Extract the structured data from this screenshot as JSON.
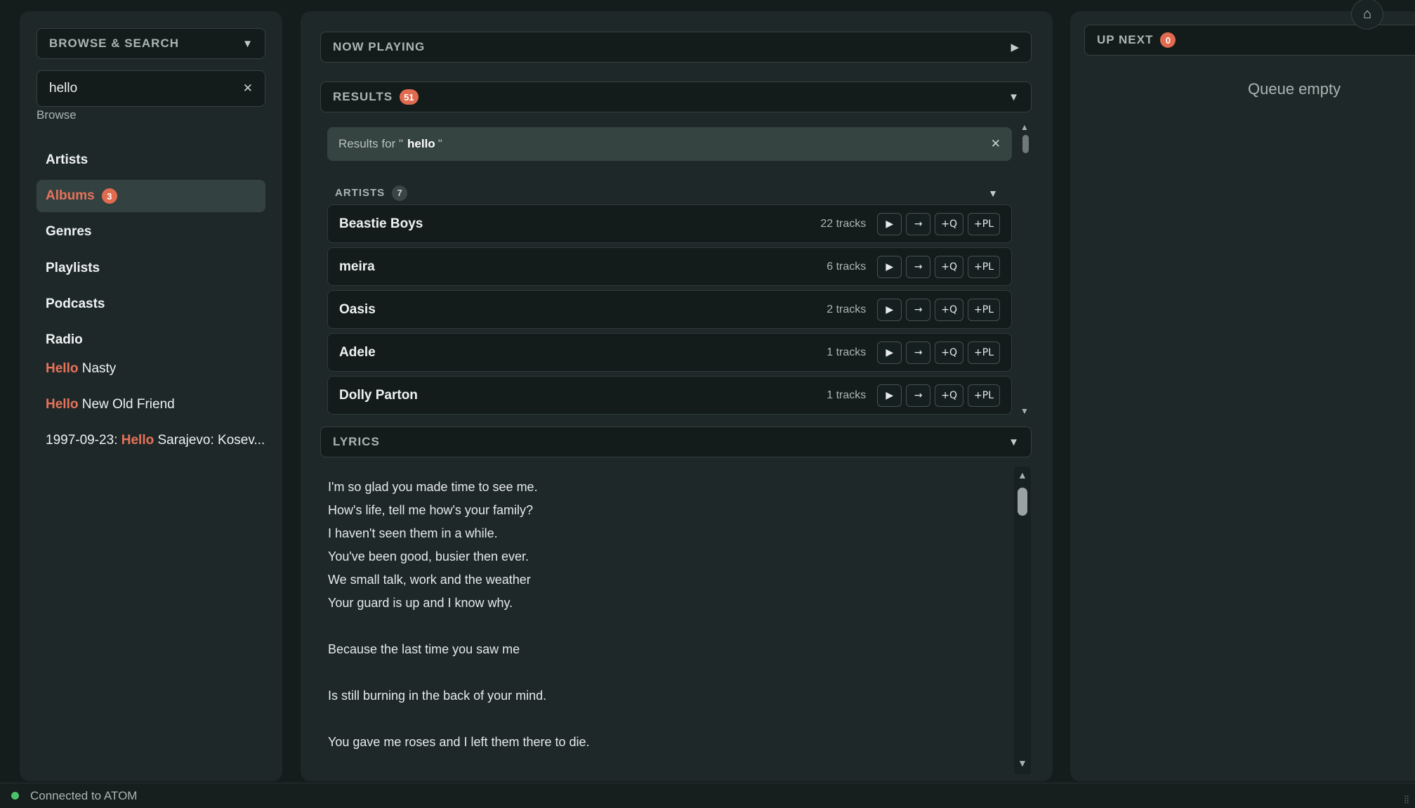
{
  "left": {
    "browse_title": "BROWSE & SEARCH",
    "search": {
      "value": "hello"
    },
    "browse_label": "Browse",
    "nav": [
      {
        "label": "Artists"
      },
      {
        "label": "Albums",
        "badge": "3"
      },
      {
        "label": "Genres"
      },
      {
        "label": "Playlists"
      },
      {
        "label": "Podcasts"
      },
      {
        "label": "Radio"
      }
    ],
    "suggestions": [
      {
        "prefix": "",
        "highlight": "Hello",
        "suffix": " Nasty"
      },
      {
        "prefix": "",
        "highlight": "Hello",
        "suffix": " New Old Friend"
      },
      {
        "prefix": "1997-09-23: ",
        "highlight": "Hello",
        "suffix": " Sarajevo: Kosev..."
      }
    ]
  },
  "center": {
    "now_playing_title": "NOW PLAYING",
    "results_title": "RESULTS",
    "results_count": "51",
    "results_for_prefix": "Results for \"",
    "results_for_query": "hello",
    "results_for_suffix": "\"",
    "artists_title": "ARTISTS",
    "artists_count": "7",
    "artists": [
      {
        "name": "Beastie Boys",
        "tracks": "22 tracks"
      },
      {
        "name": "meira",
        "tracks": "6 tracks"
      },
      {
        "name": "Oasis",
        "tracks": "2 tracks"
      },
      {
        "name": "Adele",
        "tracks": "1 tracks"
      },
      {
        "name": "Dolly Parton",
        "tracks": "1 tracks"
      }
    ],
    "actions": {
      "play": "▶",
      "next": "→",
      "queue": "+Q",
      "playlist": "+PL"
    },
    "lyrics_title": "LYRICS",
    "lyrics": [
      "I'm so glad you made time to see me.",
      "How's life, tell me how's your family?",
      "I haven't seen them in a while.",
      "You've been good, busier then ever.",
      "We small talk, work and the weather",
      "Your guard is up and I know why.",
      "",
      "Because the last time you saw me",
      "",
      "Is still burning in the back of your mind.",
      "",
      "You gave me roses and I left them there to die."
    ]
  },
  "right": {
    "up_next_title": "UP NEXT",
    "up_next_count": "0",
    "queue_empty": "Queue empty"
  },
  "status": {
    "text": "Connected to ATOM"
  },
  "icons": {
    "dropdown": "chevron-down-icon",
    "play": "play-icon",
    "close": "close-icon",
    "home": "home-icon"
  }
}
